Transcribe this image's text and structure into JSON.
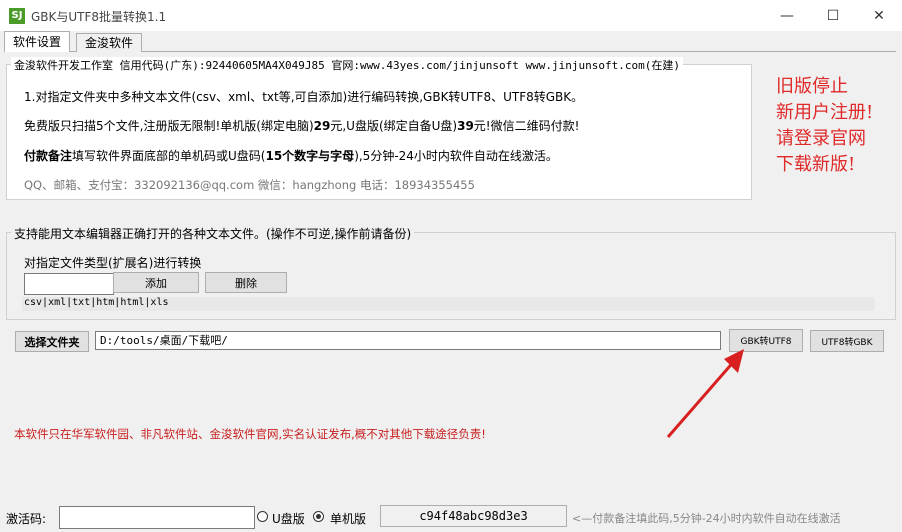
{
  "window": {
    "title": "GBK与UTF8批量转换1.1",
    "icon_label": "SJ",
    "minimize": "—",
    "maximize": "☐",
    "close": "✕"
  },
  "tabs": [
    {
      "label": "软件设置",
      "active": true
    },
    {
      "label": "金浚软件",
      "active": false
    }
  ],
  "info": {
    "title": "金浚软件开发工作室 信用代码(广东):92440605MA4X049J85 官网:www.43yes.com/jinjunsoft  www.jinjunsoft.com(在建)",
    "line1": "1.对指定文件夹中多种文本文件(csv、xml、txt等,可自添加)进行编码转换,GBK转UTF8、UTF8转GBK。",
    "line2_a": "免费版只扫描5个文件,注册版无限制!单机版(绑定电脑)",
    "line2_b": "29",
    "line2_c": "元,U盘版(绑定自备U盘)",
    "line2_d": "39",
    "line2_e": "元!微信二维码付款!",
    "line3_a": "付款备注",
    "line3_b": "填写软件界面底部的单机码或U盘码(",
    "line3_c": "15个数字与字母",
    "line3_d": "),5分钟-24小时内软件自动在线激活。",
    "contact": "QQ、邮箱、支付宝：332092136@qq.com    微信：hangzhong    电话：18934355455"
  },
  "side_notice": [
    "旧版停止",
    "新用户注册!",
    "请登录官网",
    "下载新版!"
  ],
  "support": {
    "title": "支持能用文本编辑器正确打开的各种文本文件。(操作不可逆,操作前请备份)",
    "filetype_label": "对指定文件类型(扩展名)进行转换",
    "ext_input_value": "",
    "add_label": "添加",
    "delete_label": "删除",
    "ext_list": "csv|xml|txt|htm|html|xls"
  },
  "folder": {
    "select_label": "选择文件夹",
    "path_value": "D:/tools/桌面/下载吧/"
  },
  "convert": {
    "gbk_to_utf8": "GBK转UTF8",
    "utf8_to_gbk": "UTF8转GBK"
  },
  "disclaimer": "本软件只在华军软件园、非凡软件站、金浚软件官网,实名认证发布,概不对其他下载途径负责!",
  "status": {
    "activation_label": "激活码:",
    "activation_value": "",
    "udisk_label": "U盘版",
    "single_label": "单机版",
    "selected": "单机版",
    "machine_code": "c94f48abc98d3e3",
    "payment_hint": "<—付款备注填此码,5分钟-24小时内软件自动在线激活"
  },
  "colors": {
    "notice_red": "#e02a2a",
    "arrow_red": "#d82020"
  }
}
